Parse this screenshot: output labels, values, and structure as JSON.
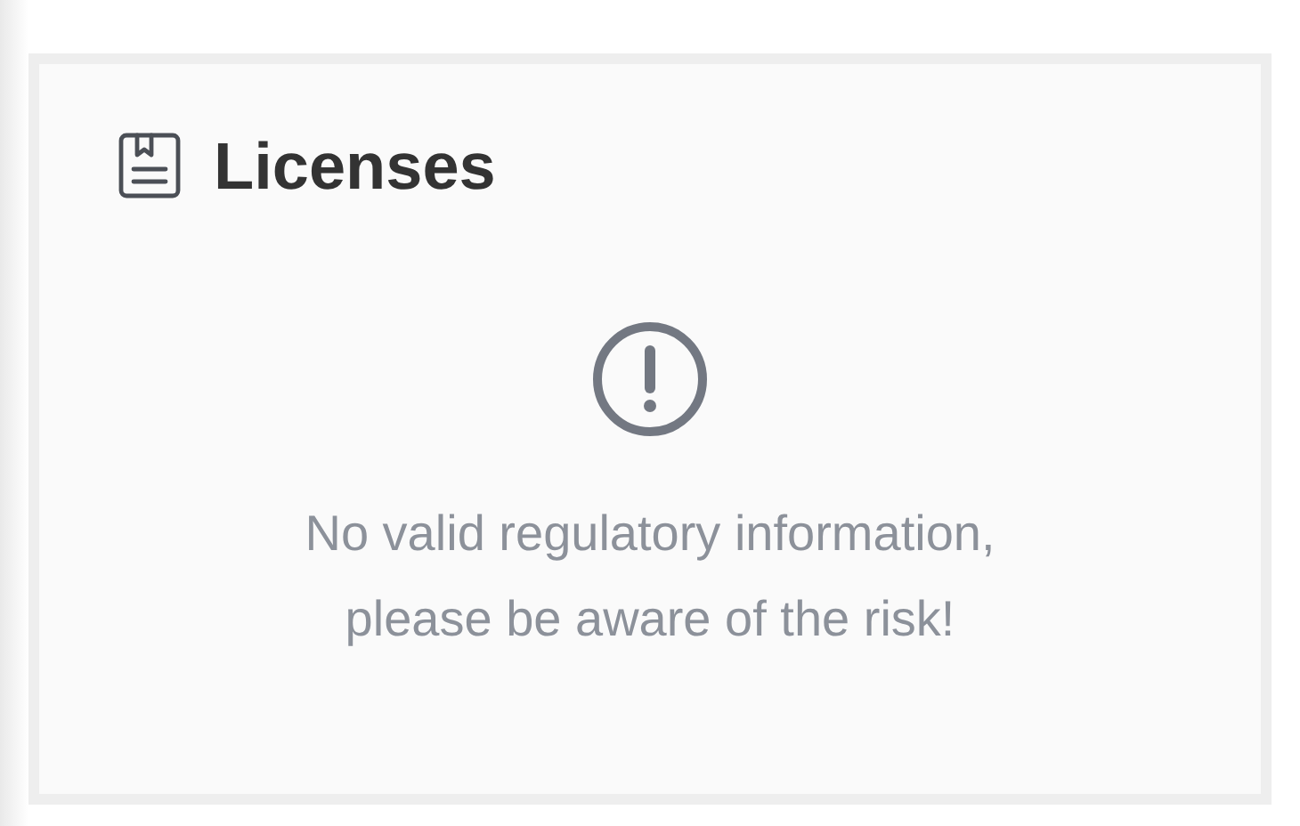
{
  "card": {
    "title": "Licenses",
    "notice": {
      "lines": [
        "No valid regulatory information,",
        "please be aware of the risk!"
      ]
    }
  }
}
